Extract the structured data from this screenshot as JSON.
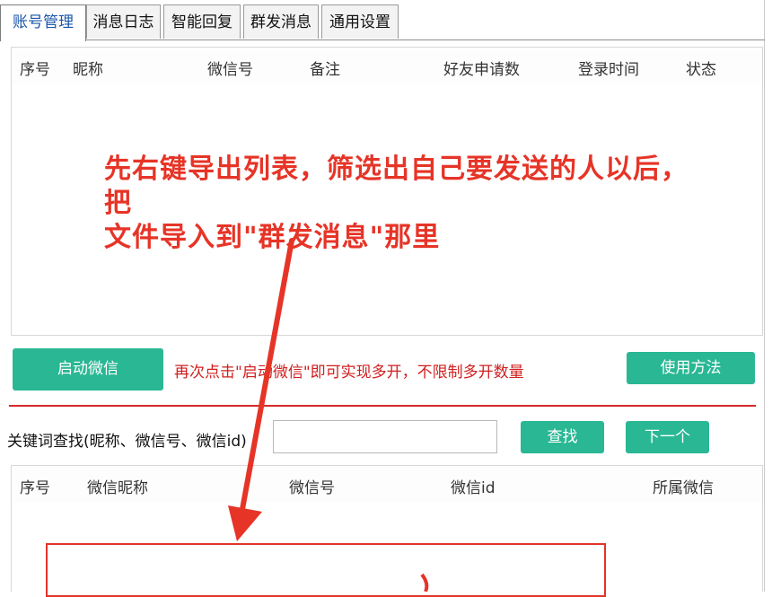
{
  "tabs": [
    {
      "label": "账号管理",
      "active": true
    },
    {
      "label": "消息日志",
      "active": false
    },
    {
      "label": "智能回复",
      "active": false
    },
    {
      "label": "群发消息",
      "active": false
    },
    {
      "label": "通用设置",
      "active": false
    }
  ],
  "account_table": {
    "columns": [
      "序号",
      "昵称",
      "微信号",
      "备注",
      "好友申请数",
      "登录时间",
      "状态"
    ],
    "rows": []
  },
  "actions": {
    "launch_label": "启动微信",
    "hint": "再次点击\"启动微信\"即可实现多开，不限制多开数量",
    "usage_label": "使用方法"
  },
  "search": {
    "label": "关键词查找(昵称、微信号、微信id)",
    "value": "",
    "find_label": "查找",
    "next_label": "下一个"
  },
  "contact_table": {
    "columns": [
      "序号",
      "微信昵称",
      "微信号",
      "微信id",
      "所属微信"
    ],
    "rows": []
  },
  "annotation": {
    "line1": "先右键导出列表，筛选出自己要发送的人以后，把",
    "line2": "文件导入到\"群发消息\"那里"
  },
  "colors": {
    "accent_button": "#29b794",
    "annotation_red": "#e63427",
    "active_tab_text": "#1a56a8"
  }
}
